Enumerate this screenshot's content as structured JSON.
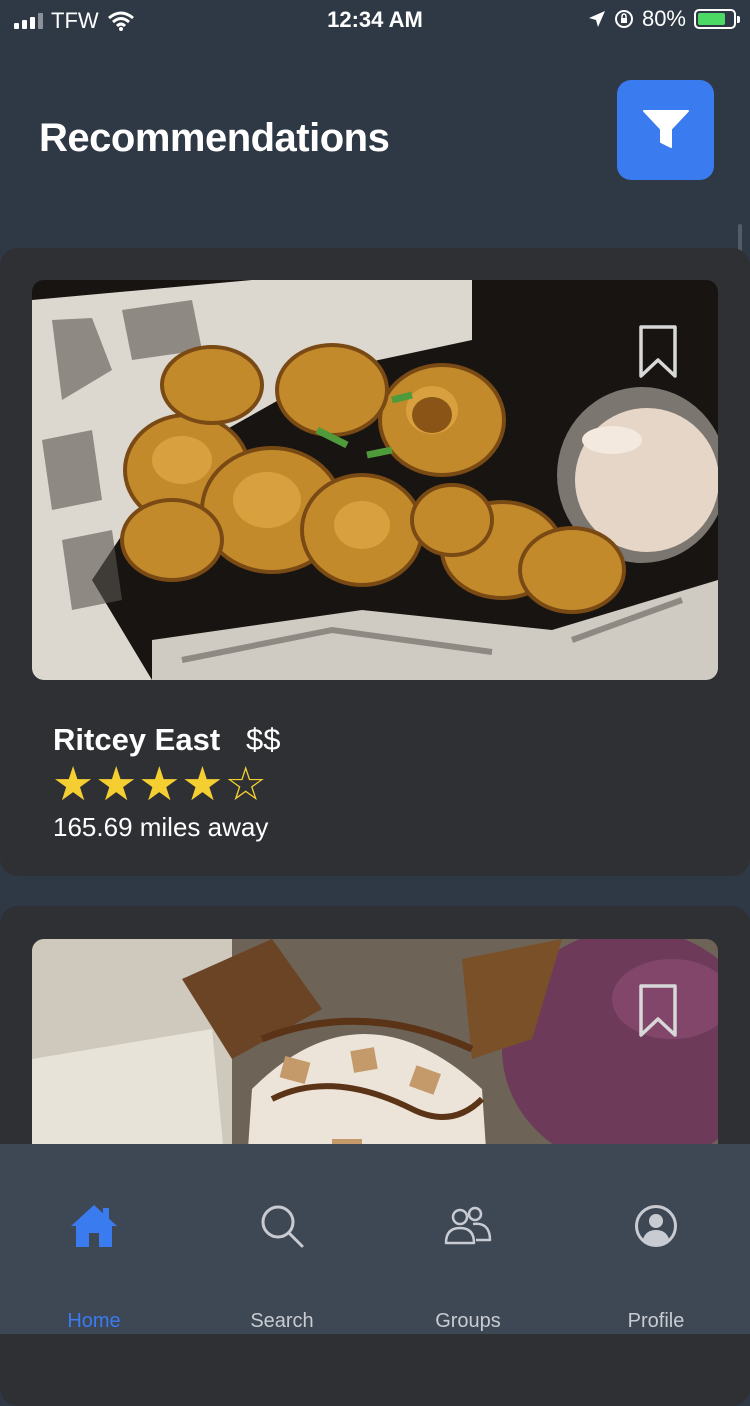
{
  "status_bar": {
    "carrier": "TFW",
    "time": "12:34 AM",
    "battery": "80%",
    "battery_level": 0.8
  },
  "header": {
    "title": "Recommendations",
    "filter_icon": "filter-icon"
  },
  "cards": [
    {
      "name": "Ritcey East",
      "price": "$$",
      "rating": 4,
      "rating_max": 5,
      "distance": "165.69 miles away",
      "bookmark_icon": "bookmark-icon"
    },
    {
      "bookmark_icon": "bookmark-icon"
    }
  ],
  "tabbar": {
    "items": [
      {
        "label": "Home",
        "icon": "home-icon",
        "active": true
      },
      {
        "label": "Search",
        "icon": "search-icon",
        "active": false
      },
      {
        "label": "Groups",
        "icon": "groups-icon",
        "active": false
      },
      {
        "label": "Profile",
        "icon": "profile-icon",
        "active": false
      }
    ],
    "active_color": "#3a7bf0"
  },
  "colors": {
    "background": "#2f3845",
    "card": "#2e3034",
    "accent": "#3a7bf0",
    "star": "#f5cf32"
  }
}
